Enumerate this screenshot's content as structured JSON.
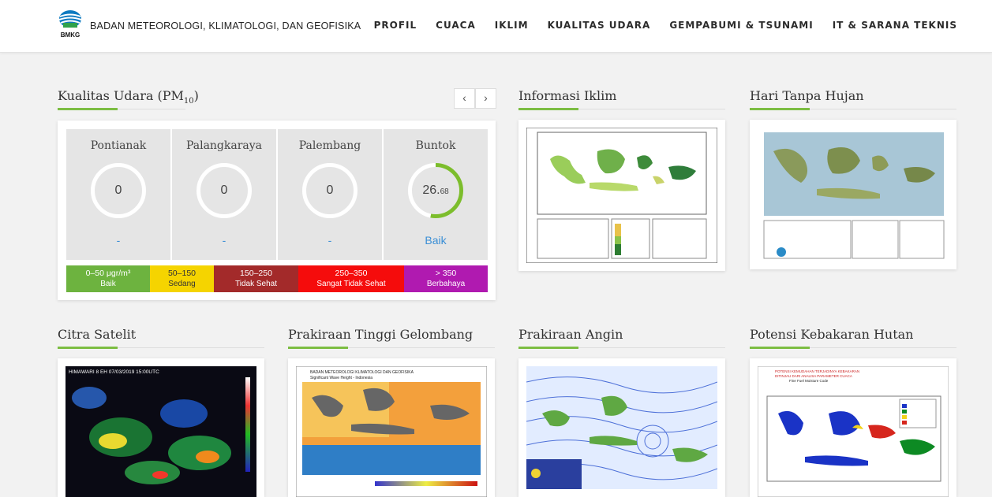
{
  "header": {
    "logo_text": "BMKG",
    "org_name": "BADAN METEOROLOGI, KLIMATOLOGI, DAN GEOFISIKA",
    "nav": [
      "PROFIL",
      "CUACA",
      "IKLIM",
      "KUALITAS UDARA",
      "GEMPABUMI & TSUNAMI",
      "IT & SARANA TEKNIS"
    ]
  },
  "air_quality": {
    "title": "Kualitas Udara (PM",
    "title_sub": "10",
    "title_end": ")",
    "prev_icon": "chevron-left-icon",
    "next_icon": "chevron-right-icon",
    "cities": [
      {
        "name": "Pontianak",
        "value": "0",
        "decimals": "",
        "status": "-",
        "level": 0
      },
      {
        "name": "Palangkaraya",
        "value": "0",
        "decimals": "",
        "status": "-",
        "level": 0
      },
      {
        "name": "Palembang",
        "value": "0",
        "decimals": "",
        "status": "-",
        "level": 0
      },
      {
        "name": "Buntok",
        "value": "26.",
        "decimals": "68",
        "status": "Baik",
        "level": 0.53
      }
    ],
    "legend": [
      {
        "range": "0–50 μgr/m³",
        "label": "Baik",
        "color": "#6db33f"
      },
      {
        "range": "50–150",
        "label": "Sedang",
        "color": "#f5d400"
      },
      {
        "range": "150–250",
        "label": "Tidak Sehat",
        "color": "#a32a2a"
      },
      {
        "range": "250–350",
        "label": "Sangat Tidak Sehat",
        "color": "#f50c0c"
      },
      {
        "range": "> 350",
        "label": "Berbahaya",
        "color": "#b01ab0"
      }
    ],
    "ring_color": "#7cbd2c"
  },
  "sections": {
    "informasi_iklim": "Informasi Iklim",
    "hari_tanpa_hujan": "Hari Tanpa Hujan",
    "citra_satelit": "Citra Satelit",
    "gelombang": "Prakiraan Tinggi Gelombang",
    "angin": "Prakiraan Angin",
    "kebakaran": "Potensi Kebakaran Hutan"
  },
  "images": {
    "satelit_caption": "HIMAWARI 8 EH 07/03/2019 15:00UTC",
    "gelombang_caption": "BADAN METEOROLOGI KLIMATOLOGI DAN GEOFISIKA",
    "gelombang_sub": "Significant Wave Height - Indonesia",
    "kebakaran_caption": "POTENSI KEMUDAHAN TERJADINYA KEBAKARAN",
    "kebakaran_sub": "DITINJAU DARI ANALISA PARAMETER CUACA",
    "kebakaran_sub2": "Fine Fuel Moisture Code"
  },
  "accent_color": "#7cbd42"
}
